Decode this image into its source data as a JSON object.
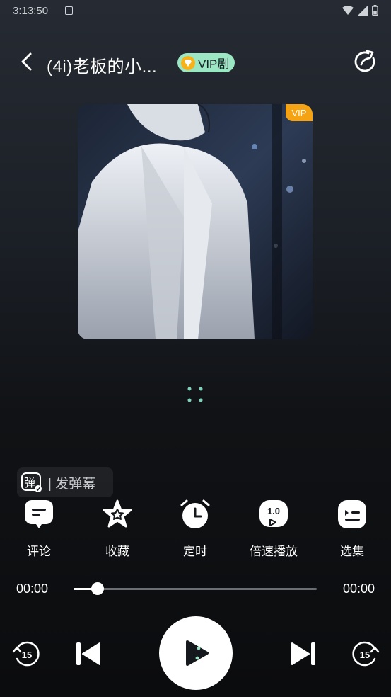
{
  "status": {
    "time": "3:13:50"
  },
  "header": {
    "title": "(4i)老板的小...",
    "vip_badge": "VIP剧"
  },
  "cover": {
    "vip_tag": "VIP"
  },
  "danmaku": {
    "icon_char": "弹",
    "label": "| 发弹幕"
  },
  "actions": [
    {
      "label": "评论",
      "icon": "comment-icon"
    },
    {
      "label": "收藏",
      "icon": "star-icon"
    },
    {
      "label": "定时",
      "icon": "alarm-clock-icon"
    },
    {
      "label": "倍速播放",
      "icon": "speed-icon",
      "speed": "1.0"
    },
    {
      "label": "选集",
      "icon": "episode-list-icon"
    }
  ],
  "player": {
    "current_time": "00:00",
    "total_time": "00:00",
    "progress": 0.1,
    "rewind_seconds": "15",
    "forward_seconds": "15"
  },
  "colors": {
    "accent": "#9be6c3",
    "vip_orange": "#f6a313"
  }
}
